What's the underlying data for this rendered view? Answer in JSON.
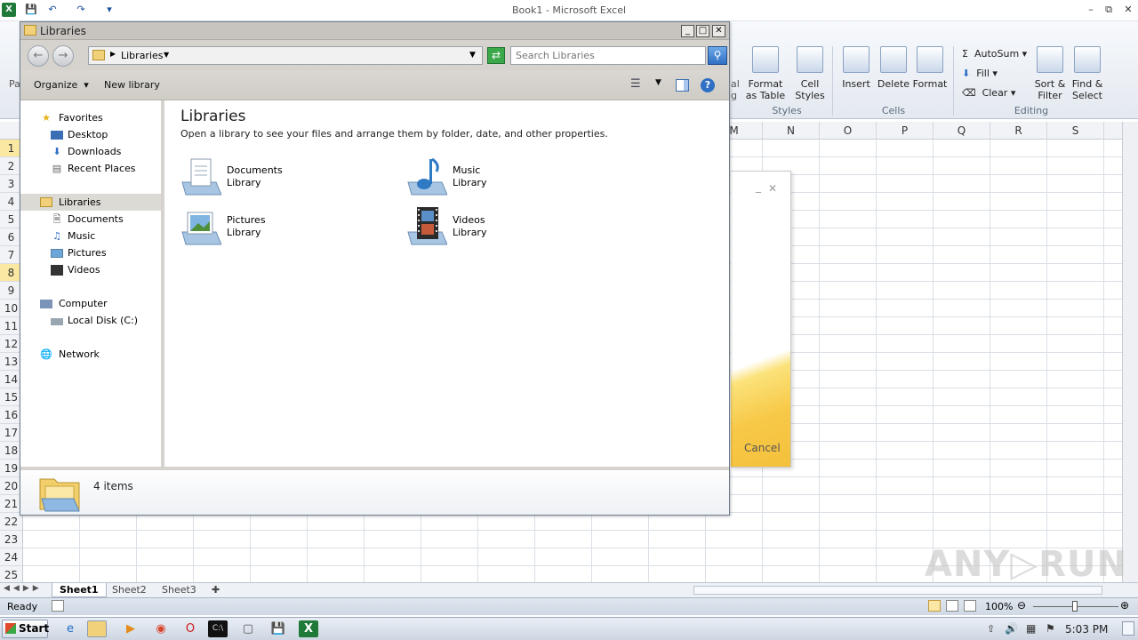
{
  "excel": {
    "title": "Book1 - Microsoft Excel",
    "ribbon": {
      "format_as_table": [
        "Format",
        "as Table"
      ],
      "cell_styles": [
        "Cell",
        "Styles"
      ],
      "styles_group": "Styles",
      "insert": "Insert",
      "delete": "Delete",
      "format": "Format",
      "cells_group": "Cells",
      "autosum": "AutoSum",
      "fill": "Fill",
      "clear": "Clear",
      "sort_filter": [
        "Sort &",
        "Filter"
      ],
      "find_select": [
        "Find &",
        "Select"
      ],
      "editing_group": "Editing",
      "partial_left_a": "Pa",
      "partial_left_b": "al",
      "partial_left_c": "g"
    },
    "columns": [
      "M",
      "N",
      "O",
      "P",
      "Q",
      "R",
      "S"
    ],
    "rows": [
      "1",
      "2",
      "3",
      "4",
      "5",
      "6",
      "7",
      "8",
      "9",
      "10",
      "11",
      "12",
      "13",
      "14",
      "15",
      "16",
      "17",
      "18",
      "19",
      "20",
      "21",
      "22",
      "23",
      "24",
      "25"
    ],
    "sheets": [
      "Sheet1",
      "Sheet2",
      "Sheet3"
    ],
    "status": "Ready",
    "zoom": "100%"
  },
  "bg_dialog": {
    "cancel_label": "Cancel"
  },
  "explorer": {
    "window_title": "Libraries",
    "address_path": "Libraries",
    "search_placeholder": "Search Libraries",
    "organize_label": "Organize",
    "new_library_label": "New library",
    "nav": {
      "favorites": "Favorites",
      "desktop": "Desktop",
      "downloads": "Downloads",
      "recent_places": "Recent Places",
      "libraries": "Libraries",
      "documents": "Documents",
      "music": "Music",
      "pictures": "Pictures",
      "videos": "Videos",
      "computer": "Computer",
      "local_disk": "Local Disk (C:)",
      "network": "Network"
    },
    "content_title": "Libraries",
    "content_desc": "Open a library to see your files and arrange them by folder, date, and other properties.",
    "libraries": [
      {
        "name": "Documents",
        "type": "Library"
      },
      {
        "name": "Music",
        "type": "Library"
      },
      {
        "name": "Pictures",
        "type": "Library"
      },
      {
        "name": "Videos",
        "type": "Library"
      }
    ],
    "items_count": "4 items"
  },
  "taskbar": {
    "start_label": "Start",
    "clock": "5:03 PM"
  },
  "watermark": "ANY▷RUN"
}
